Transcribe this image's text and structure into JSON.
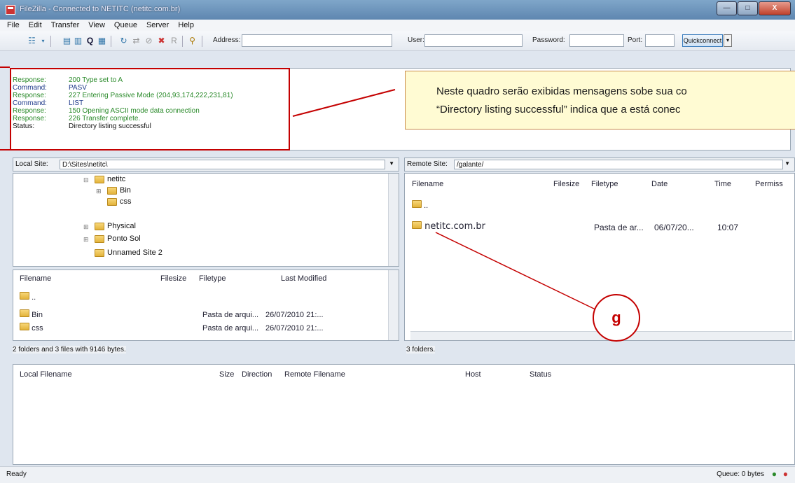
{
  "window": {
    "title": "FileZilla - Connected to NETITC (netitc.com.br)",
    "min": "—",
    "max": "□",
    "close": "X"
  },
  "menu": [
    "File",
    "Edit",
    "Transfer",
    "View",
    "Queue",
    "Server",
    "Help"
  ],
  "quickconnect": {
    "address_label": "Address:",
    "user_label": "User:",
    "password_label": "Password:",
    "port_label": "Port:",
    "button": "Quickconnect"
  },
  "log": [
    {
      "label": "Response:",
      "text": "200 Type set to A",
      "kind": "resp"
    },
    {
      "label": "Command:",
      "text": "PASV",
      "kind": "cmd"
    },
    {
      "label": "Response:",
      "text": "227 Entering Passive Mode (204,93,174,222,231,81)",
      "kind": "resp"
    },
    {
      "label": "Command:",
      "text": "LIST",
      "kind": "cmd"
    },
    {
      "label": "Response:",
      "text": "150 Opening ASCII mode data connection",
      "kind": "resp"
    },
    {
      "label": "Response:",
      "text": "226 Transfer complete.",
      "kind": "resp"
    },
    {
      "label": "Status:",
      "text": "Directory listing successful",
      "kind": "stat"
    }
  ],
  "callout": {
    "line1": "Neste quadro serão exibidas mensagens sobe sua co",
    "line2": "“Directory listing successful” indica que a está conec"
  },
  "local": {
    "site_label": "Local Site:",
    "site_path": "D:\\Sites\\netitc\\",
    "tree": [
      "netitc",
      "Bin",
      "css",
      "Physical",
      "Ponto Sol",
      "Unnamed Site 2"
    ],
    "headers": {
      "filename": "Filename",
      "filesize": "Filesize",
      "filetype": "Filetype",
      "modified": "Last Modified"
    },
    "files": [
      {
        "name": "..",
        "type": "",
        "modified": ""
      },
      {
        "name": "Bin",
        "type": "Pasta de arqui...",
        "modified": "26/07/2010 21:..."
      },
      {
        "name": "css",
        "type": "Pasta de arqui...",
        "modified": "26/07/2010 21:..."
      }
    ],
    "status": "2 folders and 3 files with 9146 bytes."
  },
  "remote": {
    "site_label": "Remote Site:",
    "site_path": "/galante/",
    "headers": {
      "filename": "Filename",
      "filesize": "Filesize",
      "filetype": "Filetype",
      "date": "Date",
      "time": "Time",
      "perms": "Permiss"
    },
    "files": [
      {
        "name": "..",
        "type": "",
        "date": "",
        "time": ""
      },
      {
        "name": "netitc.com.br",
        "type": "Pasta de ar...",
        "date": "06/07/20...",
        "time": "10:07"
      }
    ],
    "status": "3 folders."
  },
  "queue": {
    "headers": {
      "local": "Local Filename",
      "size": "Size",
      "direction": "Direction",
      "remote": "Remote Filename",
      "host": "Host",
      "status": "Status"
    }
  },
  "annotation": {
    "marker": "g"
  },
  "statusbar": {
    "ready": "Ready",
    "queue": "Queue: 0 bytes"
  }
}
